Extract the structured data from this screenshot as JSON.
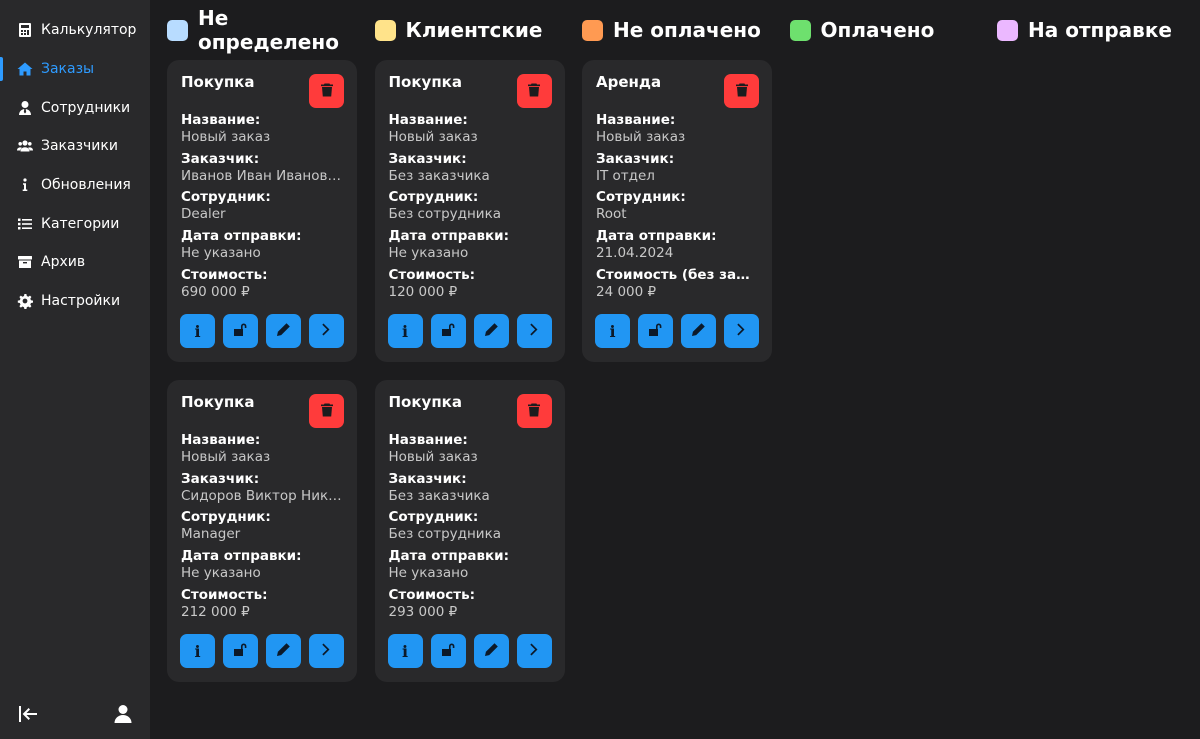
{
  "sidebar": {
    "items": [
      {
        "label": "Калькулятор",
        "icon": "calculator-icon"
      },
      {
        "label": "Заказы",
        "icon": "home-icon",
        "active": true
      },
      {
        "label": "Сотрудники",
        "icon": "user-tie-icon"
      },
      {
        "label": "Заказчики",
        "icon": "users-icon"
      },
      {
        "label": "Обновления",
        "icon": "info-icon"
      },
      {
        "label": "Категории",
        "icon": "list-icon"
      },
      {
        "label": "Архив",
        "icon": "archive-icon"
      },
      {
        "label": "Настройки",
        "icon": "gear-icon"
      }
    ],
    "bottom": {
      "logout_icon": "logout-icon",
      "profile_icon": "user-icon"
    }
  },
  "legend": [
    {
      "label": "Не определено",
      "color": "#b8dcff"
    },
    {
      "label": "Клиентские",
      "color": "#ffe38a"
    },
    {
      "label": "Не оплачено",
      "color": "#ff9a52"
    },
    {
      "label": "Оплачено",
      "color": "#6ee06e"
    },
    {
      "label": "На отправке",
      "color": "#ebb8ff"
    }
  ],
  "colors": {
    "accent": "#2e9bff",
    "action_button": "#2196f3",
    "delete_button": "#ff3b3b"
  },
  "cards": [
    {
      "type": "Покупка",
      "fields": [
        {
          "label": "Название:",
          "value": "Новый заказ"
        },
        {
          "label": "Заказчик:",
          "value": "Иванов Иван Иванович"
        },
        {
          "label": "Сотрудник:",
          "value": "Dealer"
        },
        {
          "label": "Дата отправки:",
          "value": "Не указано"
        },
        {
          "label": "Стоимость:",
          "value": "690 000 ₽"
        }
      ]
    },
    {
      "type": "Покупка",
      "fields": [
        {
          "label": "Название:",
          "value": "Новый заказ"
        },
        {
          "label": "Заказчик:",
          "value": "Без заказчика"
        },
        {
          "label": "Сотрудник:",
          "value": "Без сотрудника"
        },
        {
          "label": "Дата отправки:",
          "value": "Не указано"
        },
        {
          "label": "Стоимость:",
          "value": "120 000 ₽"
        }
      ]
    },
    {
      "type": "Аренда",
      "fields": [
        {
          "label": "Название:",
          "value": "Новый заказ"
        },
        {
          "label": "Заказчик:",
          "value": "IT отдел"
        },
        {
          "label": "Сотрудник:",
          "value": "Root"
        },
        {
          "label": "Дата отправки:",
          "value": "21.04.2024"
        },
        {
          "label": "Стоимость (без залог...",
          "value": "24 000 ₽"
        }
      ]
    },
    {
      "type": "Покупка",
      "fields": [
        {
          "label": "Название:",
          "value": "Новый заказ"
        },
        {
          "label": "Заказчик:",
          "value": "Сидоров Виктор Нико..."
        },
        {
          "label": "Сотрудник:",
          "value": "Manager"
        },
        {
          "label": "Дата отправки:",
          "value": "Не указано"
        },
        {
          "label": "Стоимость:",
          "value": "212 000 ₽"
        }
      ]
    },
    {
      "type": "Покупка",
      "fields": [
        {
          "label": "Название:",
          "value": "Новый заказ"
        },
        {
          "label": "Заказчик:",
          "value": "Без заказчика"
        },
        {
          "label": "Сотрудник:",
          "value": "Без сотрудника"
        },
        {
          "label": "Дата отправки:",
          "value": "Не указано"
        },
        {
          "label": "Стоимость:",
          "value": "293 000 ₽"
        }
      ]
    }
  ],
  "card_actions": {
    "delete_icon": "trash-icon",
    "buttons": [
      "info-icon",
      "unlock-icon",
      "pencil-icon",
      "chevron-right-icon"
    ]
  }
}
